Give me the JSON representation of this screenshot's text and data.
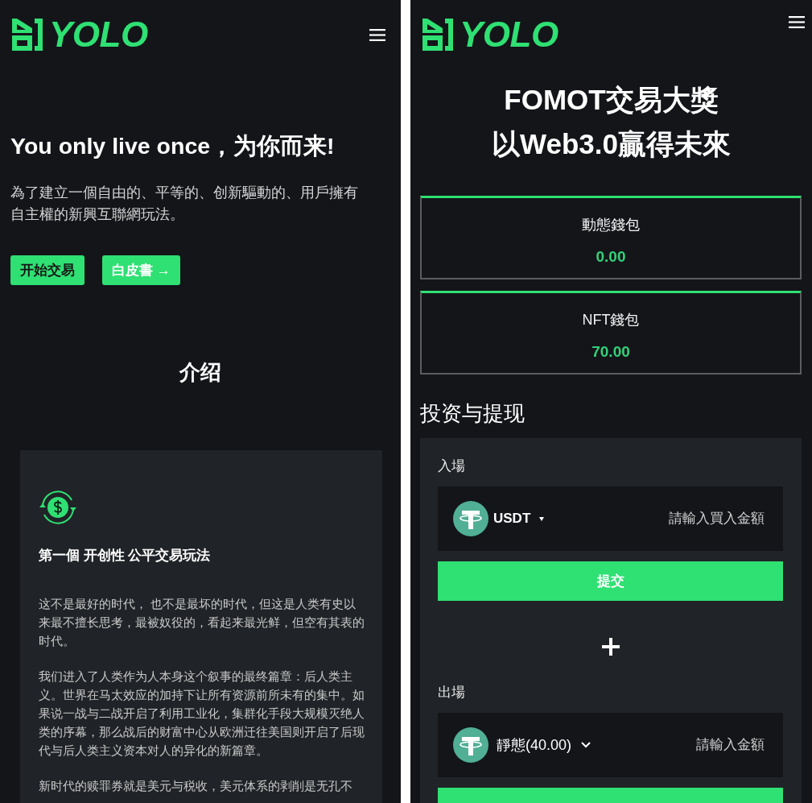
{
  "left_screen": {
    "header": {
      "logo_text": "YOLO"
    },
    "hero": {
      "title": "You only live once，为你而来!",
      "description": "為了建立一個自由的、平等的、创新驅動的、用戶擁有自主權的新興互聯網玩法。",
      "buttons": [
        {
          "label": "开始交易",
          "kind": "primary"
        },
        {
          "label": "白皮書 →",
          "kind": "secondary"
        }
      ]
    },
    "intro": {
      "heading": "介绍",
      "card": {
        "title": "第一個 开创性 公平交易玩法",
        "paragraphs": [
          "这不是最好的时代， 也不是最坏的时代，但这是人类有史以来最不擅长思考，最被奴役的，看起来最光鲜，但空有其表的时代。",
          "我们进入了人类作为人本身这个叙事的最终篇章：后人类主义。世界在马太效应的加持下让所有资源前所未有的集中。如果说一战与二战开启了利用工业化，集群化手段大规模灭绝人类的序幕，那么战后的财富中心从欧洲迁往美国则开启了后现代与后人类主义资本对人的异化的新篇章。",
          "新时代的赎罪券就是美元与税收，美元体系的剥削是无孔不"
        ]
      }
    }
  },
  "right_screen": {
    "header": {
      "logo_text": "YOLO"
    },
    "hero": {
      "title_lines": [
        "FOMOT交易大獎",
        "以Web3.0贏得未來"
      ]
    },
    "wallets": [
      {
        "label": "動態錢包",
        "value": "0.00"
      },
      {
        "label": "NFT錢包",
        "value": "70.00"
      }
    ],
    "invest": {
      "heading": "投资与提现",
      "sections": [
        {
          "label": "入場",
          "token": {
            "text": "USDT",
            "kind": "caret"
          },
          "placeholder": "請輸入買入金額",
          "has_button": true,
          "button_label": "提交"
        },
        {
          "label": "出場",
          "token": {
            "text": "靜態(40.00)",
            "kind": "chevron"
          },
          "placeholder": "請輸入金額",
          "has_button": true
        }
      ]
    }
  }
}
